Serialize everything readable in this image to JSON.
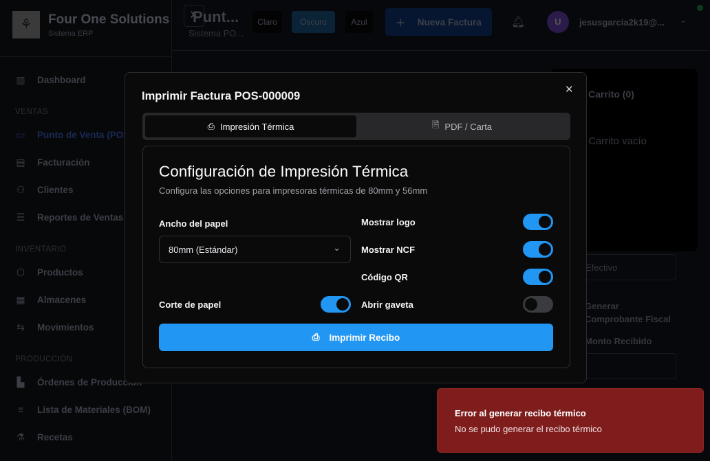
{
  "brand": {
    "name": "Four One Solutions",
    "subtitle": "Sistema ERP"
  },
  "sidebar": {
    "items": [
      {
        "label": "Dashboard",
        "icon": "chart-icon"
      },
      {
        "section": "VENTAS"
      },
      {
        "label": "Punto de Venta (POS)",
        "icon": "credit-card-icon"
      },
      {
        "label": "Facturación",
        "icon": "file-icon"
      },
      {
        "label": "Clientes",
        "icon": "users-icon"
      },
      {
        "label": "Reportes de Ventas",
        "icon": "report-icon"
      },
      {
        "section": "INVENTARIO"
      },
      {
        "label": "Productos",
        "icon": "box-icon"
      },
      {
        "label": "Almacenes",
        "icon": "warehouse-icon"
      },
      {
        "label": "Movimientos",
        "icon": "arrows-icon"
      },
      {
        "section": "PRODUCCIÓN"
      },
      {
        "label": "Órdenes de Producción",
        "icon": "factory-icon"
      },
      {
        "label": "Lista de Materiales (BOM)",
        "icon": "list-icon"
      },
      {
        "label": "Recetas",
        "icon": "flask-icon"
      }
    ]
  },
  "header": {
    "title": "Punt...",
    "subtitle": "Sistema PO...",
    "themes": [
      "Claro",
      "Oscuro",
      "Azul"
    ],
    "new_invoice": "Nueva Factura",
    "user_initial": "U",
    "user_email": "jesusgarcia2k19@..."
  },
  "background": {
    "cart_title": "Carrito (0)",
    "cart_empty": "Carrito vacío",
    "payment": "Efectivo",
    "fiscal": "Generar Comprobante Fiscal",
    "received": "Monto Recibido"
  },
  "modal": {
    "title": "Imprimir Factura POS-000009",
    "tabs": [
      "Impresión Térmica",
      "PDF / Carta"
    ],
    "heading": "Configuración de Impresión Térmica",
    "description": "Configura las opciones para impresoras térmicas de 80mm y 56mm",
    "paper_width_label": "Ancho del papel",
    "paper_width_value": "80mm (Estándar)",
    "paper_cut_label": "Corte de papel",
    "paper_cut": true,
    "options": [
      {
        "label": "Mostrar logo",
        "on": true
      },
      {
        "label": "Mostrar NCF",
        "on": true
      },
      {
        "label": "Código QR",
        "on": true
      },
      {
        "label": "Abrir gaveta",
        "on": false
      }
    ],
    "print_button": "Imprimir Recibo"
  },
  "toast": {
    "title": "Error al generar recibo térmico",
    "message": "No se pudo generar el recibo térmico"
  },
  "colors": {
    "accent": "#2196f3",
    "error": "#7f1d1d"
  }
}
